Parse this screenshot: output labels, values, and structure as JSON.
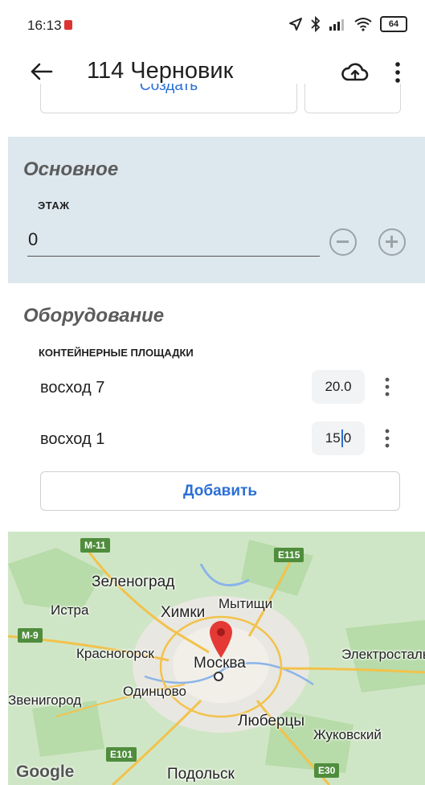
{
  "status_bar": {
    "time": "16:13",
    "battery": "64"
  },
  "toolbar": {
    "title": "114 Черновик"
  },
  "partial": {
    "left_button_label": "Создать"
  },
  "main_section": {
    "heading": "Основное",
    "floor_label": "ЭТАЖ",
    "floor_value": "0"
  },
  "equipment": {
    "heading": "Оборудование",
    "subheading": "КОНТЕЙНЕРНЫЕ ПЛОЩАДКИ",
    "items": [
      {
        "name": "восход 7",
        "value": "20.0"
      },
      {
        "name": "восход 1",
        "value_before_cursor": "15",
        "value_after_cursor": "0"
      }
    ],
    "add_label": "Добавить"
  },
  "map": {
    "labels": {
      "zelenograd": "Зеленоград",
      "istra": "Истра",
      "khimki": "Химки",
      "mytishchi": "Мытищи",
      "krasnogorsk": "Красногорск",
      "moskva": "Москва",
      "elektrostal": "Электросталь",
      "odintsovo": "Одинцово",
      "zvenigorod": "Звенигород",
      "lyubertsy": "Люберцы",
      "zhukovsky": "Жуковский",
      "podolsk": "Подольск"
    },
    "roads": {
      "m11": "M-11",
      "e115": "E115",
      "m9": "M-9",
      "e101": "E101",
      "e30": "E30"
    },
    "attribution": "Google"
  },
  "colors": {
    "accent": "#2a6fd6",
    "section_bg": "#dde7ee",
    "pin": "#e53935"
  }
}
